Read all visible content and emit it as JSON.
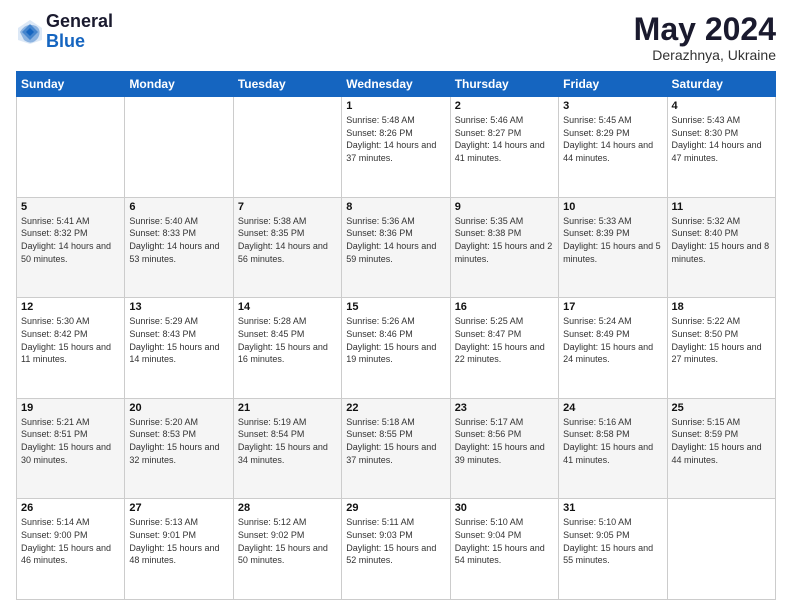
{
  "logo": {
    "general": "General",
    "blue": "Blue"
  },
  "title": "May 2024",
  "subtitle": "Derazhnya, Ukraine",
  "days_of_week": [
    "Sunday",
    "Monday",
    "Tuesday",
    "Wednesday",
    "Thursday",
    "Friday",
    "Saturday"
  ],
  "weeks": [
    [
      {
        "day": "",
        "sunrise": "",
        "sunset": "",
        "daylight": ""
      },
      {
        "day": "",
        "sunrise": "",
        "sunset": "",
        "daylight": ""
      },
      {
        "day": "",
        "sunrise": "",
        "sunset": "",
        "daylight": ""
      },
      {
        "day": "1",
        "sunrise": "Sunrise: 5:48 AM",
        "sunset": "Sunset: 8:26 PM",
        "daylight": "Daylight: 14 hours and 37 minutes."
      },
      {
        "day": "2",
        "sunrise": "Sunrise: 5:46 AM",
        "sunset": "Sunset: 8:27 PM",
        "daylight": "Daylight: 14 hours and 41 minutes."
      },
      {
        "day": "3",
        "sunrise": "Sunrise: 5:45 AM",
        "sunset": "Sunset: 8:29 PM",
        "daylight": "Daylight: 14 hours and 44 minutes."
      },
      {
        "day": "4",
        "sunrise": "Sunrise: 5:43 AM",
        "sunset": "Sunset: 8:30 PM",
        "daylight": "Daylight: 14 hours and 47 minutes."
      }
    ],
    [
      {
        "day": "5",
        "sunrise": "Sunrise: 5:41 AM",
        "sunset": "Sunset: 8:32 PM",
        "daylight": "Daylight: 14 hours and 50 minutes."
      },
      {
        "day": "6",
        "sunrise": "Sunrise: 5:40 AM",
        "sunset": "Sunset: 8:33 PM",
        "daylight": "Daylight: 14 hours and 53 minutes."
      },
      {
        "day": "7",
        "sunrise": "Sunrise: 5:38 AM",
        "sunset": "Sunset: 8:35 PM",
        "daylight": "Daylight: 14 hours and 56 minutes."
      },
      {
        "day": "8",
        "sunrise": "Sunrise: 5:36 AM",
        "sunset": "Sunset: 8:36 PM",
        "daylight": "Daylight: 14 hours and 59 minutes."
      },
      {
        "day": "9",
        "sunrise": "Sunrise: 5:35 AM",
        "sunset": "Sunset: 8:38 PM",
        "daylight": "Daylight: 15 hours and 2 minutes."
      },
      {
        "day": "10",
        "sunrise": "Sunrise: 5:33 AM",
        "sunset": "Sunset: 8:39 PM",
        "daylight": "Daylight: 15 hours and 5 minutes."
      },
      {
        "day": "11",
        "sunrise": "Sunrise: 5:32 AM",
        "sunset": "Sunset: 8:40 PM",
        "daylight": "Daylight: 15 hours and 8 minutes."
      }
    ],
    [
      {
        "day": "12",
        "sunrise": "Sunrise: 5:30 AM",
        "sunset": "Sunset: 8:42 PM",
        "daylight": "Daylight: 15 hours and 11 minutes."
      },
      {
        "day": "13",
        "sunrise": "Sunrise: 5:29 AM",
        "sunset": "Sunset: 8:43 PM",
        "daylight": "Daylight: 15 hours and 14 minutes."
      },
      {
        "day": "14",
        "sunrise": "Sunrise: 5:28 AM",
        "sunset": "Sunset: 8:45 PM",
        "daylight": "Daylight: 15 hours and 16 minutes."
      },
      {
        "day": "15",
        "sunrise": "Sunrise: 5:26 AM",
        "sunset": "Sunset: 8:46 PM",
        "daylight": "Daylight: 15 hours and 19 minutes."
      },
      {
        "day": "16",
        "sunrise": "Sunrise: 5:25 AM",
        "sunset": "Sunset: 8:47 PM",
        "daylight": "Daylight: 15 hours and 22 minutes."
      },
      {
        "day": "17",
        "sunrise": "Sunrise: 5:24 AM",
        "sunset": "Sunset: 8:49 PM",
        "daylight": "Daylight: 15 hours and 24 minutes."
      },
      {
        "day": "18",
        "sunrise": "Sunrise: 5:22 AM",
        "sunset": "Sunset: 8:50 PM",
        "daylight": "Daylight: 15 hours and 27 minutes."
      }
    ],
    [
      {
        "day": "19",
        "sunrise": "Sunrise: 5:21 AM",
        "sunset": "Sunset: 8:51 PM",
        "daylight": "Daylight: 15 hours and 30 minutes."
      },
      {
        "day": "20",
        "sunrise": "Sunrise: 5:20 AM",
        "sunset": "Sunset: 8:53 PM",
        "daylight": "Daylight: 15 hours and 32 minutes."
      },
      {
        "day": "21",
        "sunrise": "Sunrise: 5:19 AM",
        "sunset": "Sunset: 8:54 PM",
        "daylight": "Daylight: 15 hours and 34 minutes."
      },
      {
        "day": "22",
        "sunrise": "Sunrise: 5:18 AM",
        "sunset": "Sunset: 8:55 PM",
        "daylight": "Daylight: 15 hours and 37 minutes."
      },
      {
        "day": "23",
        "sunrise": "Sunrise: 5:17 AM",
        "sunset": "Sunset: 8:56 PM",
        "daylight": "Daylight: 15 hours and 39 minutes."
      },
      {
        "day": "24",
        "sunrise": "Sunrise: 5:16 AM",
        "sunset": "Sunset: 8:58 PM",
        "daylight": "Daylight: 15 hours and 41 minutes."
      },
      {
        "day": "25",
        "sunrise": "Sunrise: 5:15 AM",
        "sunset": "Sunset: 8:59 PM",
        "daylight": "Daylight: 15 hours and 44 minutes."
      }
    ],
    [
      {
        "day": "26",
        "sunrise": "Sunrise: 5:14 AM",
        "sunset": "Sunset: 9:00 PM",
        "daylight": "Daylight: 15 hours and 46 minutes."
      },
      {
        "day": "27",
        "sunrise": "Sunrise: 5:13 AM",
        "sunset": "Sunset: 9:01 PM",
        "daylight": "Daylight: 15 hours and 48 minutes."
      },
      {
        "day": "28",
        "sunrise": "Sunrise: 5:12 AM",
        "sunset": "Sunset: 9:02 PM",
        "daylight": "Daylight: 15 hours and 50 minutes."
      },
      {
        "day": "29",
        "sunrise": "Sunrise: 5:11 AM",
        "sunset": "Sunset: 9:03 PM",
        "daylight": "Daylight: 15 hours and 52 minutes."
      },
      {
        "day": "30",
        "sunrise": "Sunrise: 5:10 AM",
        "sunset": "Sunset: 9:04 PM",
        "daylight": "Daylight: 15 hours and 54 minutes."
      },
      {
        "day": "31",
        "sunrise": "Sunrise: 5:10 AM",
        "sunset": "Sunset: 9:05 PM",
        "daylight": "Daylight: 15 hours and 55 minutes."
      },
      {
        "day": "",
        "sunrise": "",
        "sunset": "",
        "daylight": ""
      }
    ]
  ]
}
